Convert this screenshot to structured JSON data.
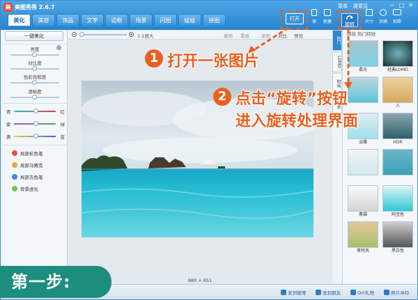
{
  "app": {
    "logo": "美",
    "title": "美图秀秀 2.6.7"
  },
  "window_controls": [
    "—",
    "□",
    "✕"
  ],
  "menu_links": [
    "菜单",
    "提意见"
  ],
  "tabs": [
    {
      "label": "美化",
      "active": true
    },
    {
      "label": "美容",
      "active": false
    },
    {
      "label": "饰品",
      "active": false
    },
    {
      "label": "文字",
      "active": false
    },
    {
      "label": "边框",
      "active": false
    },
    {
      "label": "场景",
      "active": false
    },
    {
      "label": "闪图",
      "active": false
    },
    {
      "label": "娃娃",
      "active": false
    },
    {
      "label": "拼图",
      "active": false
    }
  ],
  "toolbar": {
    "open": "打开",
    "rotate": "旋转",
    "new": "新建",
    "size": "尺寸",
    "paint": "涂鸦",
    "shoot": "拍照",
    "save": "保"
  },
  "left": {
    "one_click": "一键美化",
    "adjust": [
      "亮度",
      "对比度",
      "色彩饱和度",
      "清晰度"
    ],
    "color_rows": [
      {
        "left": "青",
        "right": "红",
        "gradient": "linear-gradient(90deg,#26c4c4,#e03b3b)"
      },
      {
        "left": "紫",
        "right": "绿",
        "gradient": "linear-gradient(90deg,#b14ad1,#3dbd4c)"
      },
      {
        "left": "黄",
        "right": "蓝",
        "gradient": "linear-gradient(90deg,#e8d23a,#3a69e8)"
      }
    ],
    "tools": [
      {
        "label": "局部彩色笔",
        "color": "#e2513c"
      },
      {
        "label": "局部马赛克",
        "color": "#e8a838"
      },
      {
        "label": "局部去色笔",
        "color": "#3c8be2"
      },
      {
        "label": "背景虚化",
        "color": "#7bc04a"
      }
    ]
  },
  "canvas": {
    "zoom_label": "1:1原大",
    "actions": [
      "撤销",
      "重做",
      "原图",
      "对比",
      "预览"
    ],
    "image_size": "980 × 651"
  },
  "right": {
    "header": "特效   热门特效",
    "vtabs": [
      "热门",
      "LOMO",
      "时尚",
      "艺术"
    ],
    "effects": [
      {
        "label": "柔光",
        "tint": "#7fd2e6"
      },
      {
        "label": "经典LOMO",
        "tint": "#3a6f78"
      },
      {
        "label": "",
        "tint": "#5cc4d8"
      },
      {
        "label": "人",
        "tint": "#d9a85a"
      },
      {
        "label": "淡雅",
        "tint": "#9fe0ea"
      },
      {
        "label": "HDR",
        "tint": "#4c7f8f"
      },
      {
        "label": "",
        "tint": "#cfe9ee"
      },
      {
        "label": "",
        "tint": "#3aa0b8"
      },
      {
        "label": "素描",
        "tint": "#e7e7e7"
      },
      {
        "label": "阿宝色",
        "tint": "#2dc9d5"
      },
      {
        "label": "哥特风",
        "tint": "#a7c06a"
      },
      {
        "label": "黑白色",
        "tint": "#7d7d7d"
      }
    ]
  },
  "statusbar": [
    "发到微博",
    "发到朋友",
    "DIY礼物",
    "照片冲印"
  ],
  "annotations": {
    "step1_num": "1",
    "step1_text": "打开一张图片",
    "step2_num": "2",
    "step2_line1": "点击“旋转”按钮",
    "step2_line2": "进入旋转处理界面",
    "step_label": "第一步:"
  }
}
